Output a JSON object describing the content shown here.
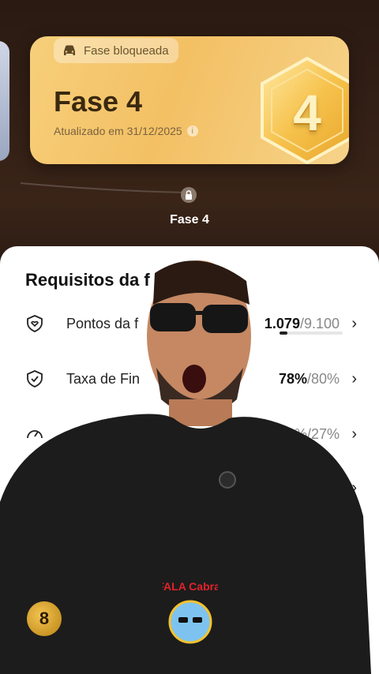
{
  "header": {
    "locked_chip_label": "Fase bloqueada",
    "phase_title": "Fase 4",
    "updated_text": "Atualizado em 31/12/2025",
    "badge_number": "4",
    "progress_label": "Fase 4",
    "progress_fraction": 1.0
  },
  "requirements": {
    "title": "Requisitos da f",
    "rows": [
      {
        "label": "Pontos da f",
        "value": "1.079",
        "target": "/9.100",
        "progress_fraction": 0.12
      },
      {
        "label": "Taxa de Fin",
        "value": "78%",
        "target": "/80%"
      },
      {
        "label": "",
        "value": "",
        "target": "%/27%"
      },
      {
        "label": "",
        "value": "",
        "target": "85"
      }
    ]
  },
  "watermark": {
    "brand": "FALA Cabral"
  },
  "colors": {
    "card_gold": "#f3c064",
    "accent_teal": "#35c39c",
    "sheet_bg": "#ffffff",
    "bg_dark": "#2a1a12"
  },
  "icons": {
    "chip": "car-icon",
    "info": "info-icon",
    "lock": "lock-icon",
    "row1": "shield-heart-icon",
    "row2": "shield-check-icon",
    "row3": "gauge-icon",
    "chevron": "chevron-right-icon"
  }
}
